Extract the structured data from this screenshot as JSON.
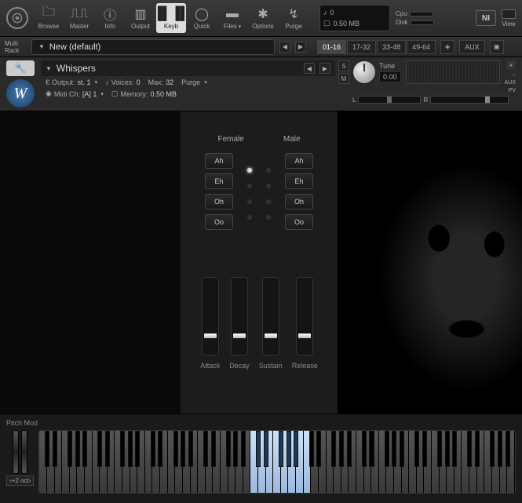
{
  "toolbar": {
    "browse": "Browse",
    "master": "Master",
    "info": "Info",
    "output": "Output",
    "keyb": "Keyb",
    "quick": "Quick",
    "files": "Files",
    "options": "Options",
    "purge": "Purge",
    "voices_icon": "♪",
    "voices_val": "0",
    "mem_icon": "□",
    "mem_val": "0.50 MB",
    "cpu": "Cpu",
    "disk": "Disk",
    "view": "View"
  },
  "rackbar": {
    "multi": "Multi",
    "rack": "Rack",
    "preset": "New (default)",
    "ranges": [
      "01-16",
      "17-32",
      "33-48",
      "49-64"
    ],
    "active_range": 0,
    "aux": "AUX"
  },
  "inst": {
    "title": "Whispers",
    "output_lbl": "Output:",
    "output_val": "st. 1",
    "voices_lbl": "Voices:",
    "voices_val": "0",
    "max_lbl": "Max:",
    "max_val": "32",
    "purge": "Purge",
    "midi_lbl": "Midi Ch:",
    "midi_val": "[A] 1",
    "mem_lbl": "Memory:",
    "mem_val": "0.50 MB",
    "tune_lbl": "Tune",
    "tune_val": "0.00",
    "s": "S",
    "m": "M",
    "l": "L",
    "r": "R",
    "aux": "AUX",
    "pv": "PV",
    "logo_letter": "W"
  },
  "panel": {
    "female": "Female",
    "male": "Male",
    "vowels": [
      "Ah",
      "Eh",
      "Oh",
      "Oo"
    ],
    "selected_female": 0,
    "adsr": [
      {
        "label": "Attack",
        "pos": 72
      },
      {
        "label": "Decay",
        "pos": 72
      },
      {
        "label": "Sustain",
        "pos": 72
      },
      {
        "label": "Release",
        "pos": 72
      }
    ]
  },
  "keyb": {
    "label": "Pitch Mod",
    "oct": "‹+2 oct›",
    "active_start": 28,
    "active_end": 35
  }
}
